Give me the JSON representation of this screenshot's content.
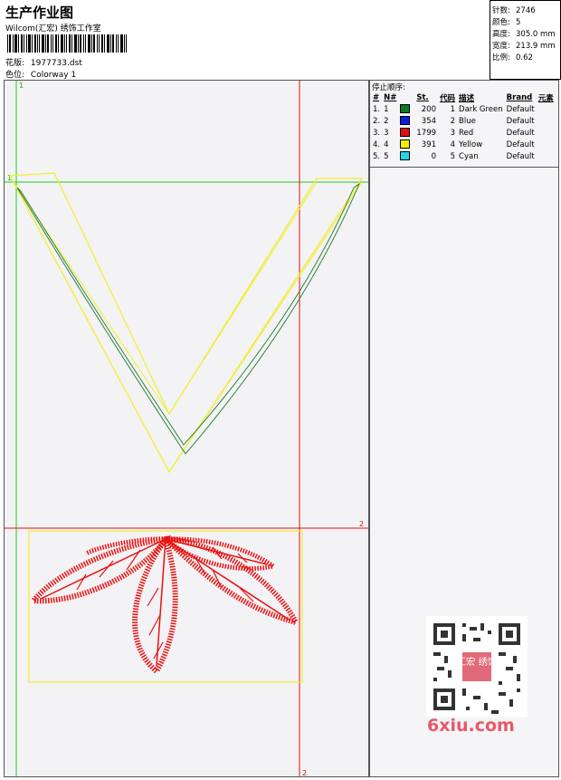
{
  "header": {
    "title": "生产作业图",
    "subtitle": "Wilcom(汇宏) 绣饰工作室",
    "design_label": "花版:",
    "design_value": "1977733.dst",
    "colorway_label": "色位:",
    "colorway_value": "Colorway 1"
  },
  "stats": [
    {
      "label": "针数:",
      "value": "2746"
    },
    {
      "label": "颜色:",
      "value": "5"
    },
    {
      "label": "高度:",
      "value": "305.0 mm"
    },
    {
      "label": "宽度:",
      "value": "213.9 mm"
    },
    {
      "label": "比例:",
      "value": "0.62"
    }
  ],
  "stop_table": {
    "heading": "停止顺序:",
    "columns": [
      "#",
      "N#",
      "St.",
      "代码",
      "描述",
      "Brand",
      "元素"
    ],
    "rows": [
      {
        "idx": "1.",
        "n": "1",
        "stitches": "200",
        "code": "1",
        "desc": "Dark Green",
        "brand": "Default",
        "color": "#0a7a22"
      },
      {
        "idx": "2.",
        "n": "2",
        "stitches": "354",
        "code": "2",
        "desc": "Blue",
        "brand": "Default",
        "color": "#0a22d8"
      },
      {
        "idx": "3.",
        "n": "3",
        "stitches": "1799",
        "code": "3",
        "desc": "Red",
        "brand": "Default",
        "color": "#e01010"
      },
      {
        "idx": "4.",
        "n": "4",
        "stitches": "391",
        "code": "4",
        "desc": "Yellow",
        "brand": "Default",
        "color": "#f4f000"
      },
      {
        "idx": "5.",
        "n": "5",
        "stitches": "0",
        "code": "5",
        "desc": "Cyan",
        "brand": "Default",
        "color": "#20d8e8"
      }
    ]
  },
  "markers": {
    "m1": "1",
    "m2": "2"
  },
  "watermark": "6xiu.com",
  "qr_text": "汇宏 绣饰"
}
